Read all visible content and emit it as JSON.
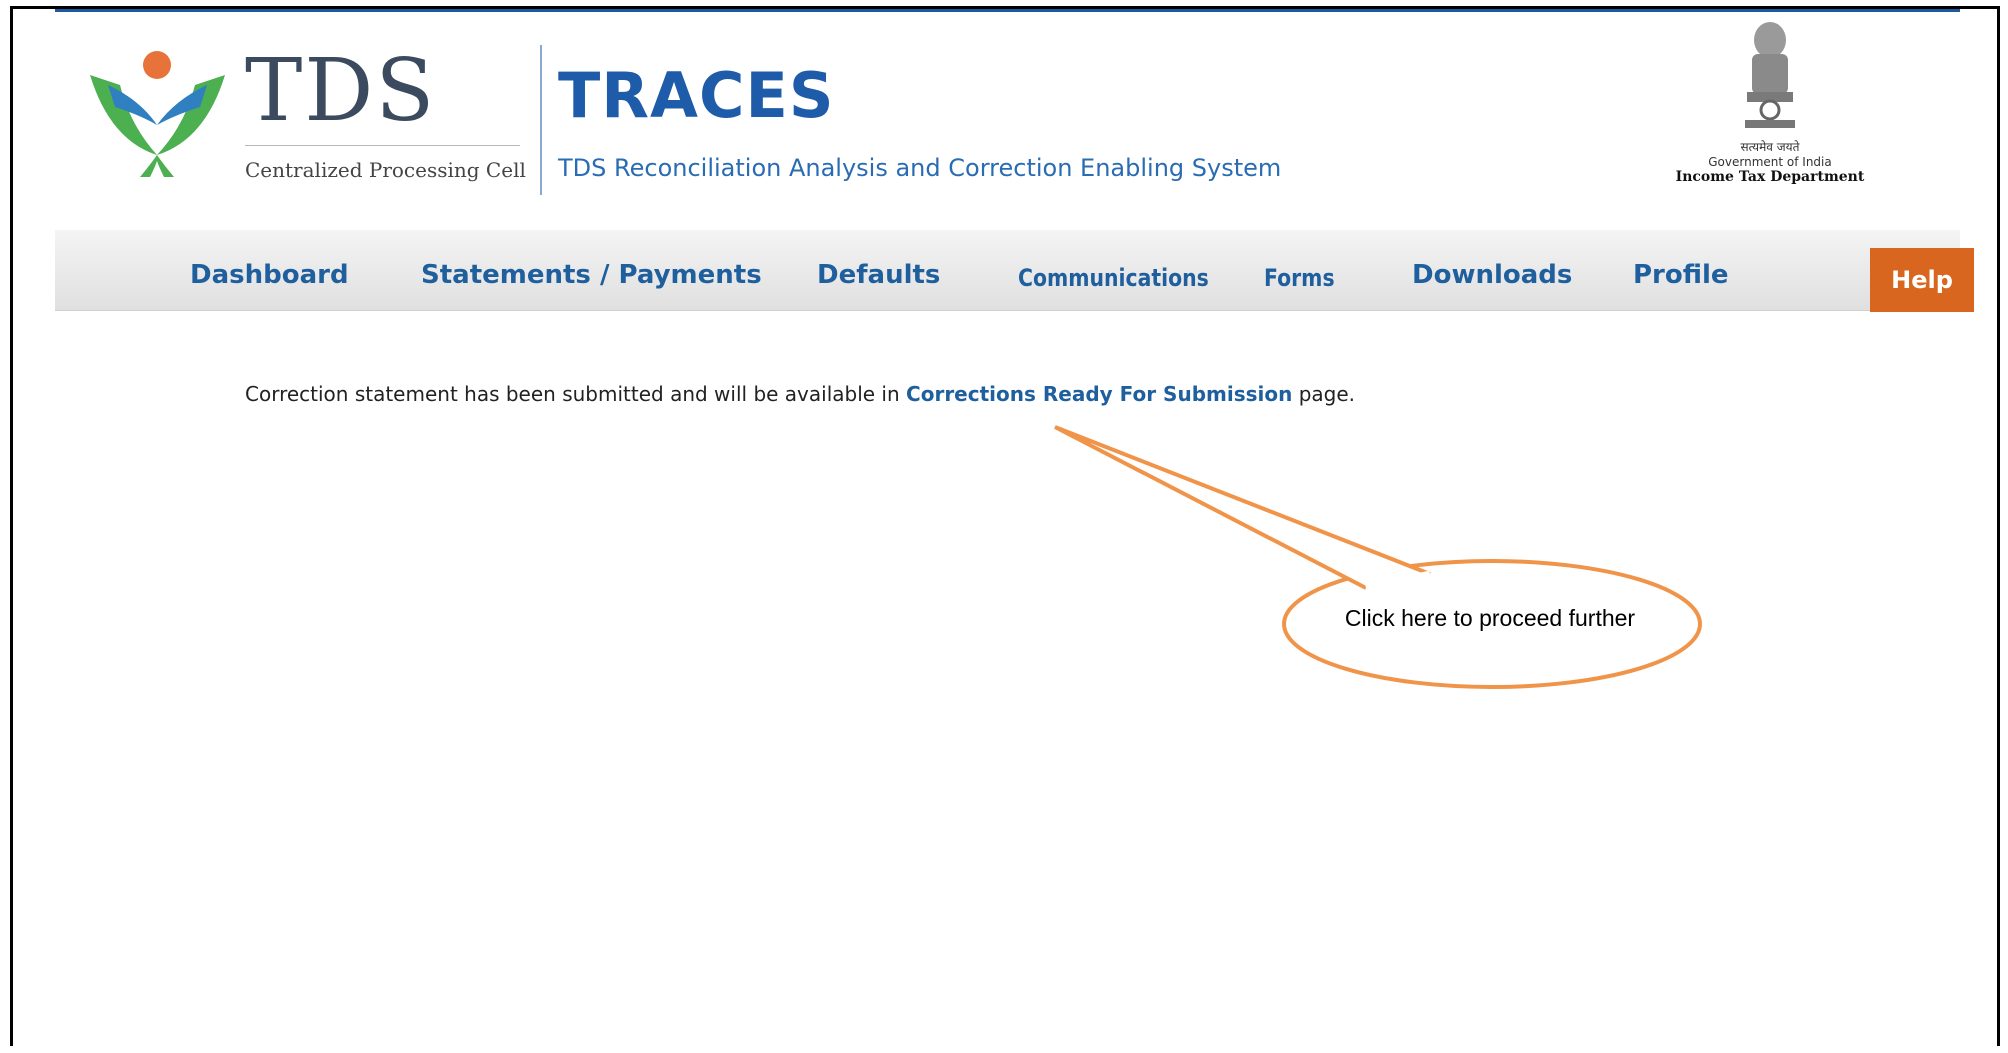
{
  "header": {
    "logo_wordmark": "TDS",
    "logo_subtitle": "Centralized Processing Cell",
    "app_title": "TRACES",
    "app_subtitle": "TDS Reconciliation Analysis and Correction Enabling System",
    "emblem_hindi": "सत्यमेव जयते",
    "emblem_govt": "Government of India",
    "emblem_dept": "Income Tax Department"
  },
  "nav": {
    "items": [
      {
        "label": "Dashboard"
      },
      {
        "label": "Statements / Payments"
      },
      {
        "label": "Defaults"
      },
      {
        "label": "Communications"
      },
      {
        "label": "Forms"
      },
      {
        "label": "Downloads"
      },
      {
        "label": "Profile"
      }
    ],
    "help_label": "Help"
  },
  "main": {
    "message_prefix": "Correction statement has been submitted and will be available in",
    "message_link": "Corrections Ready For Submission",
    "message_suffix": "page."
  },
  "annotation": {
    "callout_text": "Click here to proceed further",
    "color": "#f0944a"
  },
  "colors": {
    "brand_blue": "#1e5ca9",
    "help_orange": "#d8661f",
    "logo_green": "#4caf50",
    "logo_blue": "#2f7fc1",
    "logo_orange": "#e8733a"
  }
}
